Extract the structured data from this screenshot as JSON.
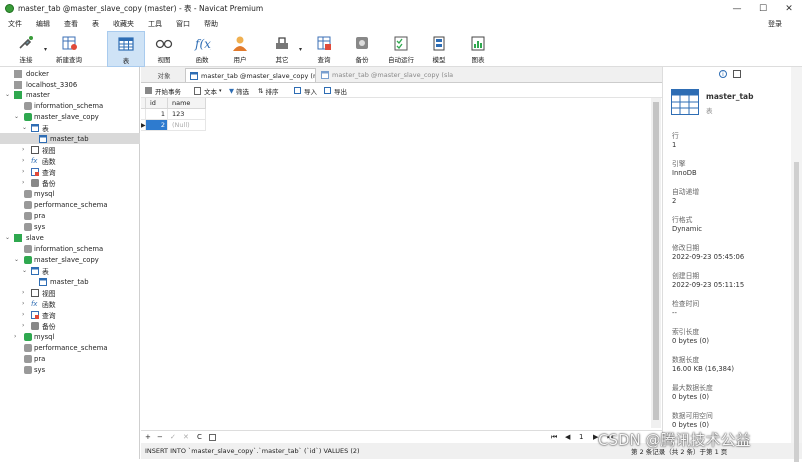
{
  "window": {
    "title": "master_tab @master_slave_copy (master) - 表 - Navicat Premium",
    "minimize": "—",
    "maximize": "☐",
    "close": "✕"
  },
  "menu": [
    "文件",
    "编辑",
    "查看",
    "表",
    "收藏夹",
    "工具",
    "窗口",
    "帮助"
  ],
  "login": "登录",
  "toolbar": {
    "connect": "连接",
    "new_query": "新建查询",
    "table": "表",
    "view": "视图",
    "function": "函数",
    "user": "用户",
    "other": "其它",
    "query": "查询",
    "backup": "备份",
    "automation": "自动运行",
    "model": "模型",
    "chart": "图表"
  },
  "tree": {
    "docker": "docker",
    "localhost": "localhost_3306",
    "master": "master",
    "information_schema": "information_schema",
    "master_slave_copy": "master_slave_copy",
    "tables": "表",
    "master_tab": "master_tab",
    "views": "视图",
    "functions": "函数",
    "queries": "查询",
    "backups": "备份",
    "mysql": "mysql",
    "performance_schema": "performance_schema",
    "pra": "pra",
    "sys": "sys",
    "slave": "slave"
  },
  "tabs": {
    "objects": "对象",
    "active": "master_tab @master_slave_copy (m...",
    "inactive": "master_tab @master_slave_copy (sla..."
  },
  "subtoolbar": {
    "begin_tx": "开始事务",
    "text": "文本",
    "filter": "筛选",
    "sort": "排序",
    "import": "导入",
    "export": "导出"
  },
  "grid": {
    "columns": [
      "id",
      "name"
    ],
    "rows": [
      [
        "1",
        "123"
      ],
      [
        "2",
        "(Null)"
      ]
    ]
  },
  "bottom": {
    "page": "1"
  },
  "status": {
    "sql": "INSERT INTO `master_slave_copy`.`master_tab` (`id`) VALUES (2)",
    "records": "第 2 条记录（共 2 条）于第 1 页"
  },
  "info": {
    "name": "master_tab",
    "type": "表",
    "items": [
      {
        "label": "行",
        "value": "1"
      },
      {
        "label": "引擎",
        "value": "InnoDB"
      },
      {
        "label": "自动递增",
        "value": "2"
      },
      {
        "label": "行格式",
        "value": "Dynamic"
      },
      {
        "label": "修改日期",
        "value": "2022-09-23 05:45:06"
      },
      {
        "label": "创建日期",
        "value": "2022-09-23 05:11:15"
      },
      {
        "label": "检查时间",
        "value": "--"
      },
      {
        "label": "索引长度",
        "value": "0 bytes (0)"
      },
      {
        "label": "数据长度",
        "value": "16.00 KB (16,384)"
      },
      {
        "label": "最大数据长度",
        "value": "0 bytes (0)"
      },
      {
        "label": "数据可用空间",
        "value": "0 bytes (0)"
      }
    ]
  },
  "watermark": "CSDN @腾讯技术公益",
  "colors": {
    "accent": "#2e7bcf",
    "selected_row": "#2e7bcf",
    "db_green": "#2fa84f",
    "active_tool": "#cfe3f6"
  }
}
